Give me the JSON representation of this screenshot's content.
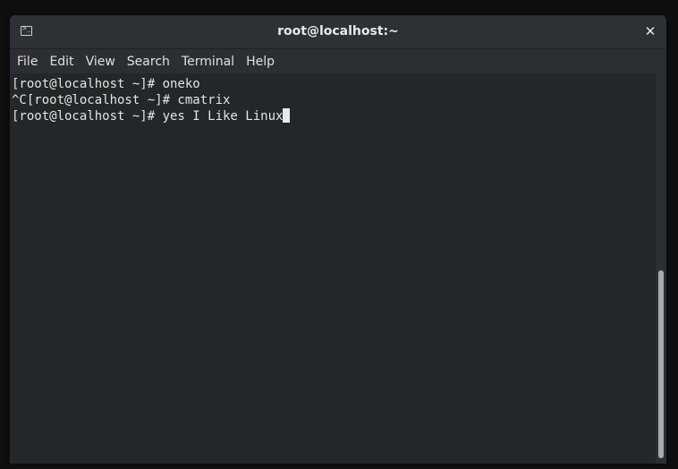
{
  "window": {
    "title": "root@localhost:~",
    "close_glyph": "✕",
    "icon": "terminal-icon",
    "icon_prompt": ">_"
  },
  "menu": {
    "items": [
      "File",
      "Edit",
      "View",
      "Search",
      "Terminal",
      "Help"
    ]
  },
  "terminal": {
    "lines": [
      "[root@localhost ~]# oneko",
      "^C[root@localhost ~]# cmatrix",
      "[root@localhost ~]# yes I Like Linux"
    ]
  },
  "colors": {
    "background": "#232729",
    "text": "#e4e4e4",
    "titlebar": "#2d3034"
  }
}
